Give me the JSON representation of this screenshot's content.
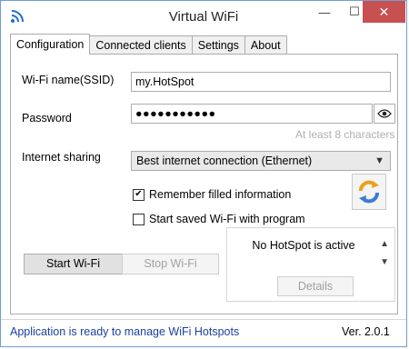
{
  "window": {
    "title": "Virtual WiFi",
    "minimize": "—",
    "maximize": "☐",
    "close": "✕"
  },
  "tabs": [
    {
      "label": "Configuration",
      "active": true
    },
    {
      "label": "Connected clients",
      "active": false
    },
    {
      "label": "Settings",
      "active": false
    },
    {
      "label": "About",
      "active": false
    }
  ],
  "form": {
    "ssid_label": "Wi-Fi name(SSID)",
    "ssid_value": "my.HotSpot",
    "password_label": "Password",
    "password_value": "●●●●●●●●●●●",
    "password_hint": "At least 8 characters",
    "sharing_label": "Internet sharing",
    "sharing_value": "Best internet connection (Ethernet)",
    "remember_label": "Remember filled information",
    "remember_checked": true,
    "autostart_label": "Start saved Wi-Fi with program",
    "autostart_checked": false
  },
  "actions": {
    "start_label": "Start Wi-Fi",
    "stop_label": "Stop Wi-Fi",
    "details_label": "Details"
  },
  "hotspot_status": "No HotSpot is active",
  "statusbar": {
    "message": "Application is ready to manage WiFi Hotspots",
    "version": "Ver. 2.0.1"
  },
  "colors": {
    "accent": "#1a3fa0",
    "close": "#c75050",
    "wifi_icon": "#1e6fd0",
    "refresh": "#e8a21c"
  },
  "icons": {
    "app": "wifi-icon",
    "eye": "eye-icon",
    "refresh": "refresh-icon"
  }
}
